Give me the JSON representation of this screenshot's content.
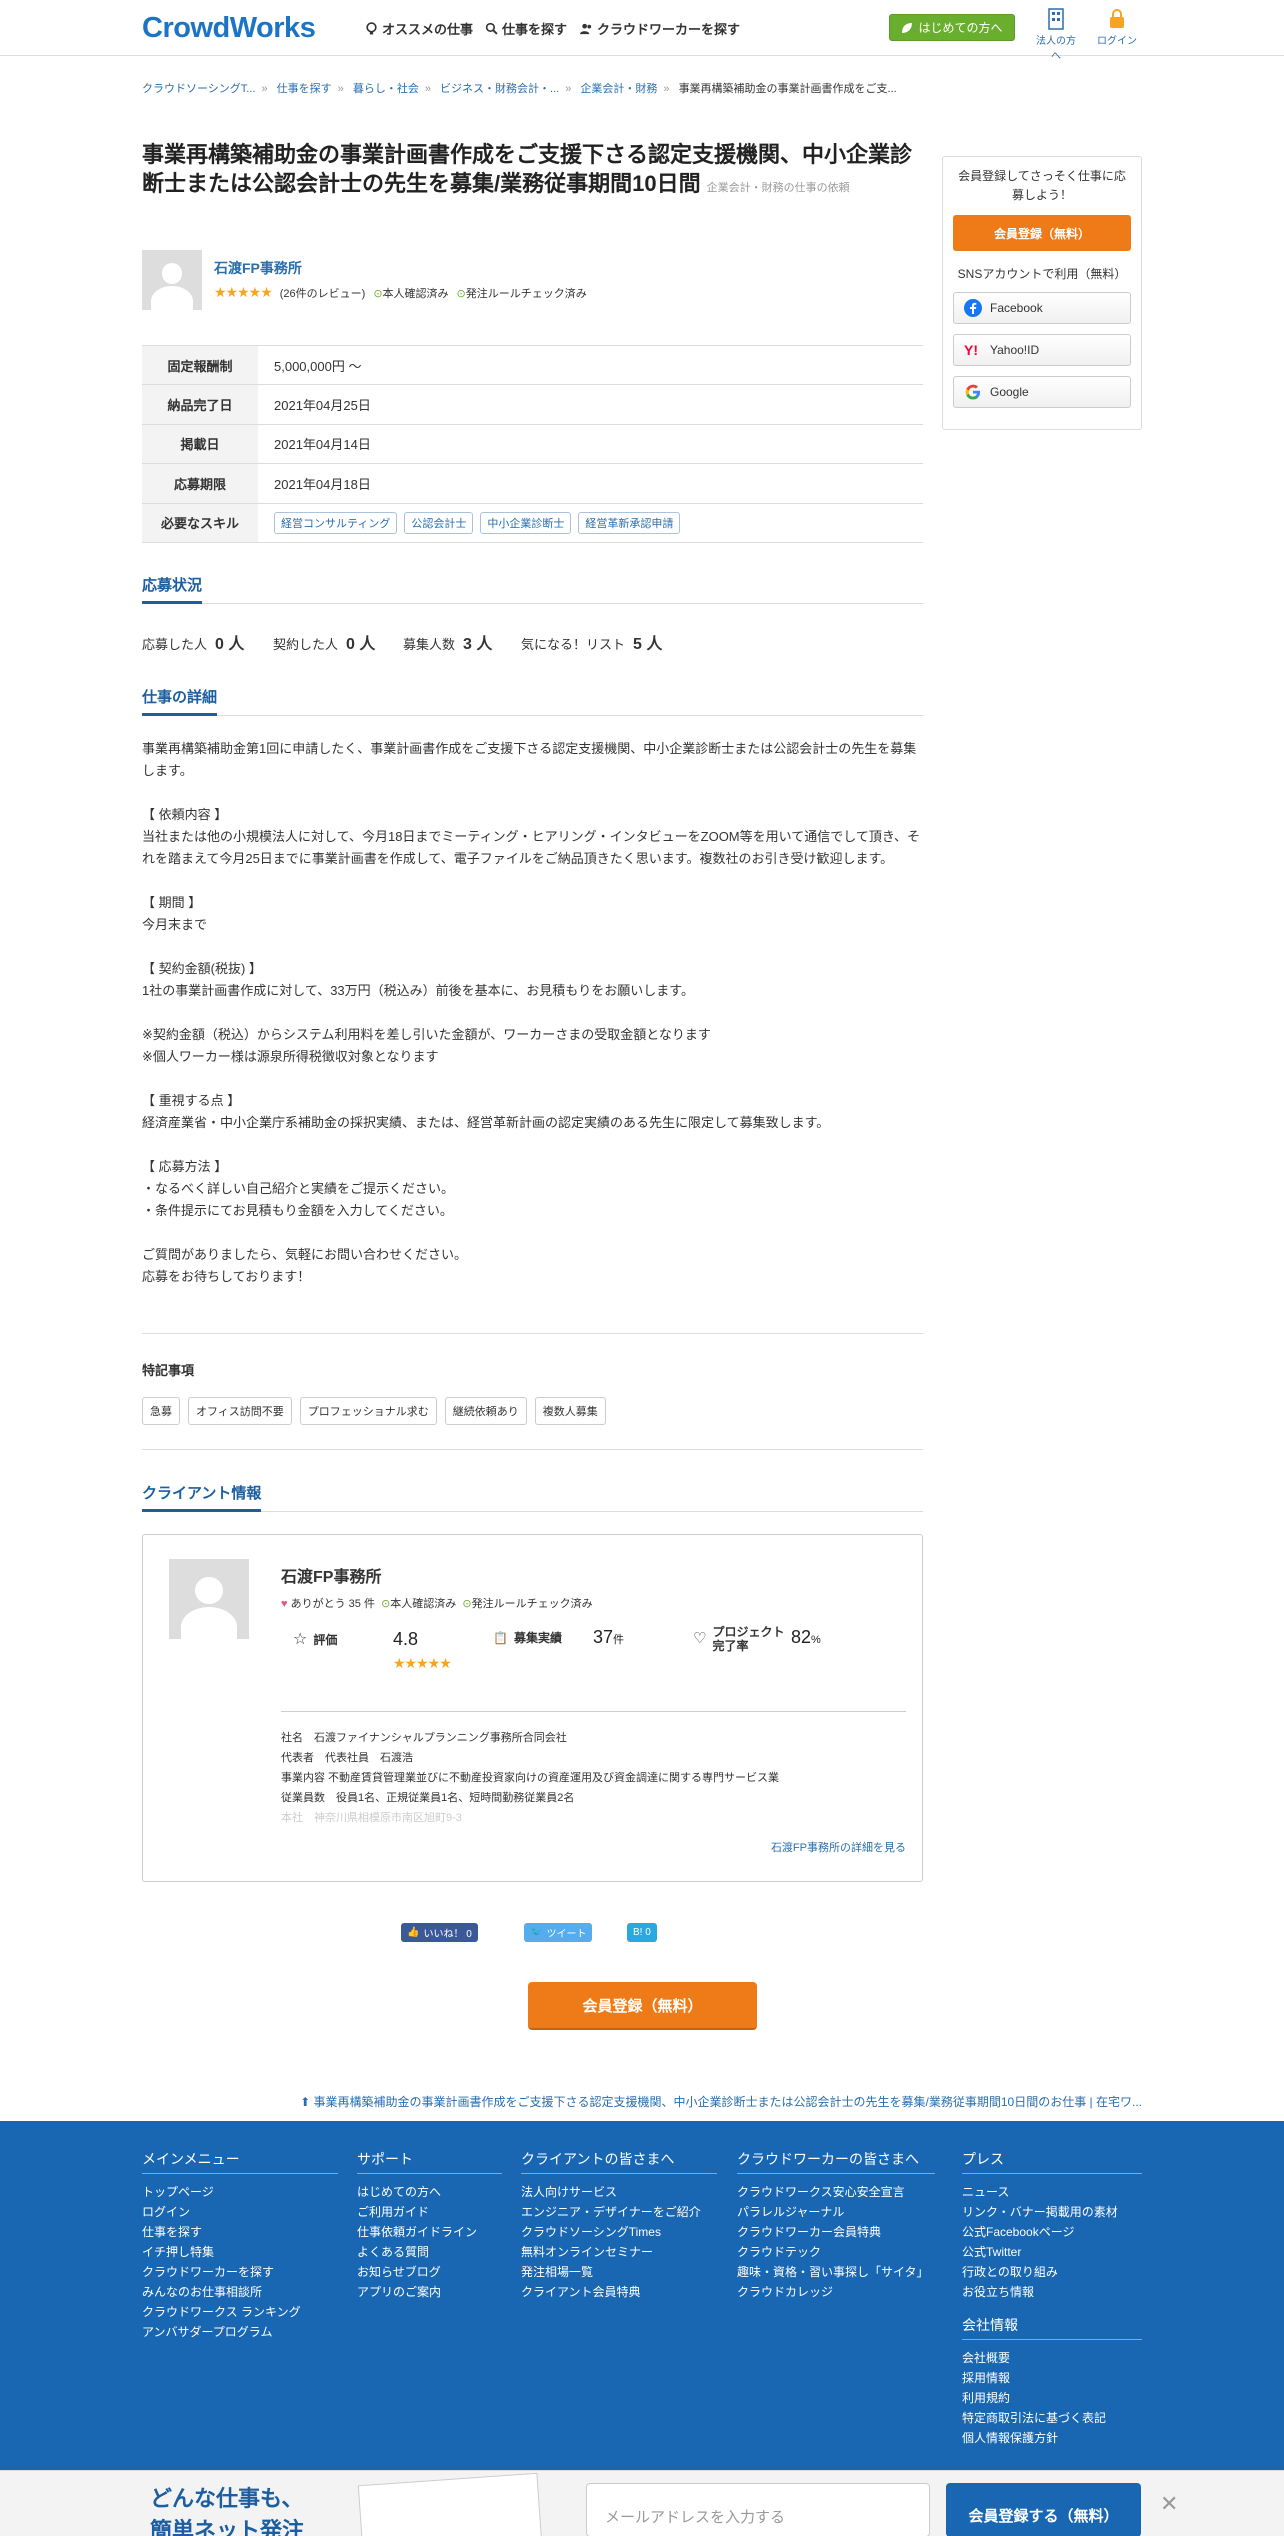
{
  "header": {
    "logo": "CrowdWorks",
    "nav": [
      "オススメの仕事",
      "仕事を探す",
      "クラウドワーカーを探す"
    ],
    "first_time": "はじめての方へ",
    "corp": "法人の方へ",
    "login": "ログイン"
  },
  "breadcrumb": [
    "クラウドソーシングT...",
    "仕事を探す",
    "暮らし・社会",
    "ビジネス・財務会計・...",
    "企業会計・財務",
    "事業再構築補助金の事業計画書作成をご支..."
  ],
  "job": {
    "title": "事業再構築補助金の事業計画書作成をご支援下さる認定支援機関、中小企業診断士または公認会計士の先生を募集/業務従事期間10日間",
    "category": "企業会計・財務の仕事の依頼",
    "client_name": "石渡FP事務所",
    "stars": "★★★★★",
    "reviews": "(26件のレビュー)",
    "verified": "本人確認済み",
    "rule_checked": "発注ルールチェック済み",
    "table": [
      {
        "label": "固定報酬制",
        "value": "5,000,000円 〜"
      },
      {
        "label": "納品完了日",
        "value": "2021年04月25日"
      },
      {
        "label": "掲載日",
        "value": "2021年04月14日"
      },
      {
        "label": "応募期限",
        "value": "2021年04月18日"
      }
    ],
    "skill_label": "必要なスキル",
    "skills": [
      "経営コンサルティング",
      "公認会計士",
      "中小企業診断士",
      "経営革新承認申請"
    ]
  },
  "status": {
    "heading": "応募状況",
    "items": [
      {
        "label": "応募した人",
        "value": "0 人"
      },
      {
        "label": "契約した人",
        "value": "0 人"
      },
      {
        "label": "募集人数",
        "value": "3 人"
      },
      {
        "label": "気になる！リスト",
        "value": "5 人"
      }
    ]
  },
  "detail": {
    "heading": "仕事の詳細",
    "body": "事業再構築補助金第1回に申請したく、事業計画書作成をご支援下さる認定支援機関、中小企業診断士または公認会計士の先生を募集します。\n\n【 依頼内容 】\n当社または他の小規模法人に対して、今月18日までミーティング・ヒアリング・インタビューをZOOM等を用いて通信でして頂き、それを踏まえて今月25日までに事業計画書を作成して、電子ファイルをご納品頂きたく思います。複数社のお引き受け歓迎します。\n\n【 期間 】\n今月末まで\n\n【 契約金額(税抜) 】\n1社の事業計画書作成に対して、33万円（税込み）前後を基本に、お見積もりをお願いします。\n\n※契約金額（税込）からシステム利用料を差し引いた金額が、ワーカーさまの受取金額となります\n※個人ワーカー様は源泉所得税徴収対象となります\n\n【 重視する点 】\n経済産業省・中小企業庁系補助金の採択実績、または、経営革新計画の認定実績のある先生に限定して募集致します。\n\n【 応募方法 】\n・なるべく詳しい自己紹介と実績をご提示ください。\n・条件提示にてお見積もり金額を入力してください。\n\nご質問がありましたら、気軽にお問い合わせください。\n応募をお待ちしております！"
  },
  "features": {
    "heading": "特記事項",
    "items": [
      "急募",
      "オフィス訪問不要",
      "プロフェッショナル求む",
      "継続依頼あり",
      "複数人募集"
    ]
  },
  "client": {
    "heading": "クライアント情報",
    "name": "石渡FP事務所",
    "thanks": "ありがとう 35 件",
    "verified": "本人確認済み",
    "rule_checked": "発注ルールチェック済み",
    "rating_label": "評価",
    "rating": "4.8",
    "stars": "★★★★★",
    "orders_label": "募集実績",
    "orders": "37",
    "orders_unit": "件",
    "complete_label1": "プロジェクト",
    "complete_label2": "完了率",
    "complete": "82",
    "complete_unit": "%",
    "info": [
      "社名　石渡ファイナンシャルプランニング事務所合同会社",
      "代表者　代表社員　石渡浩",
      "事業内容 不動産賃貸管理業並びに不動産投資家向けの資産運用及び資金調達に関する専門サービス業",
      "従業員数　役員1名、正規従業員1名、短時間勤務従業員2名"
    ],
    "info_fade": "本社　神奈川県相模原市南区旭町9-3",
    "more": "石渡FP事務所の詳細を見る"
  },
  "social": {
    "like": "いいね！ 0",
    "tweet": "ツイート",
    "hatena": "B! 0"
  },
  "cta": "会員登録（無料）",
  "breadcrumb_bottom": "事業再構築補助金の事業計画書作成をご支援下さる認定支援機関、中小企業診断士または公認会計士の先生を募集/業務従事期間10日間のお仕事 | 在宅ワ...",
  "sidebar": {
    "msg": "会員登録してさっそく仕事に応募しよう！",
    "register": "会員登録（無料）",
    "sns": "SNSアカウントで利用（無料）",
    "facebook": "Facebook",
    "yahoo": "Yahoo!ID",
    "google": "Google"
  },
  "footer": {
    "cols": [
      {
        "title": "メインメニュー",
        "items": [
          "トップページ",
          "ログイン",
          "仕事を探す",
          "イチ押し特集",
          "クラウドワーカーを探す",
          "みんなのお仕事相談所",
          "クラウドワークス ランキング",
          "アンバサダープログラム"
        ]
      },
      {
        "title": "サポート",
        "items": [
          "はじめての方へ",
          "ご利用ガイド",
          "仕事依頼ガイドライン",
          "よくある質問",
          "お知らせブログ",
          "アプリのご案内"
        ]
      },
      {
        "title": "クライアントの皆さまへ",
        "items": [
          "法人向けサービス",
          "エンジニア・デザイナーをご紹介",
          "クラウドソーシングTimes",
          "無料オンラインセミナー",
          "発注相場一覧",
          "クライアント会員特典"
        ]
      },
      {
        "title": "クラウドワーカーの皆さまへ",
        "items": [
          "クラウドワークス安心安全宣言",
          "パラレルジャーナル",
          "クラウドワーカー会員特典",
          "クラウドテック",
          "趣味・資格・習い事探し「サイタ」",
          "クラウドカレッジ"
        ]
      },
      {
        "title": "プレス",
        "items": [
          "ニュース",
          "リンク・バナー掲載用の素材",
          "公式Facebookページ",
          "公式Twitter",
          "行政との取り組み",
          "お役立ち情報"
        ]
      },
      {
        "title": "会社情報",
        "items": [
          "会社概要",
          "採用情報",
          "利用規約",
          "特定商取引法に基づく表記",
          "個人情報保護方針"
        ]
      }
    ]
  },
  "bottom_bar": {
    "ad1": "どんな仕事も、",
    "ad2": "簡単ネット発注",
    "email_placeholder": "メールアドレスを入力する",
    "join": "会員登録する（無料）",
    "close": "✕"
  }
}
